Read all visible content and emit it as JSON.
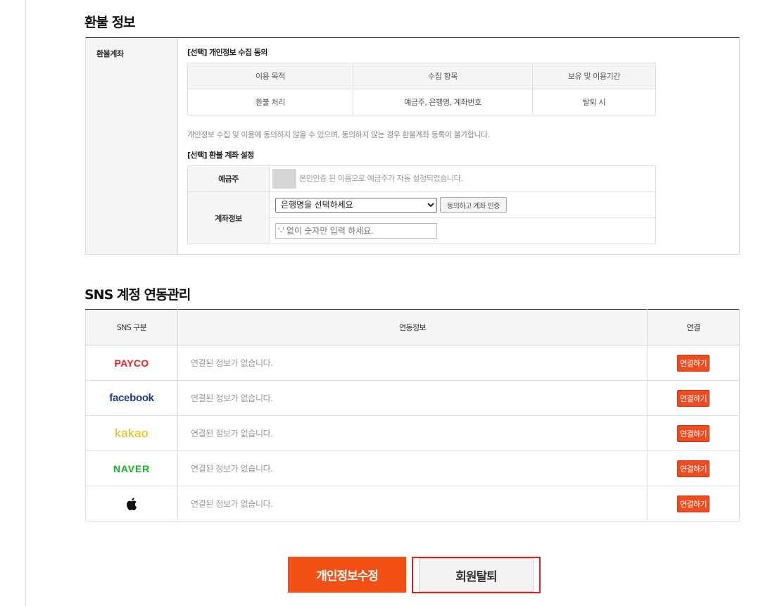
{
  "refund": {
    "title": "환불 정보",
    "row_header": "환불계좌",
    "consent_title": "[선택] 개인정보 수집 동의",
    "consent_table": {
      "headers": [
        "이용 목적",
        "수집 항목",
        "보유 및 이용기간"
      ],
      "row": [
        "환불 처리",
        "예금주, 은행명, 계좌번호",
        "탈퇴 시"
      ]
    },
    "notice": "개인정보 수집 및 이용에 동의하지 않을 수 있으며, 동의하지 않는 경우 환불계좌 등록이 불가합니다.",
    "account_title": "[선택] 환불 계좌 설정",
    "holder_label": "예금주",
    "holder_note": "본인인증 된 이름으로 예금주가 자동 설정되었습니다.",
    "account_label": "계좌정보",
    "bank_select": "은행명을 선택하세요",
    "verify_button": "동의하고 계좌 인증",
    "account_placeholder": "'-' 없이 숫자만 입력 하세요."
  },
  "sns": {
    "title": "SNS 계정 연동관리",
    "headers": [
      "SNS 구분",
      "연동정보",
      "연결"
    ],
    "rows": [
      {
        "provider": "PAYCO",
        "info": "연결된 정보가 없습니다.",
        "action": "연결하기"
      },
      {
        "provider": "facebook",
        "info": "연결된 정보가 없습니다.",
        "action": "연결하기"
      },
      {
        "provider": "kakao",
        "info": "연결된 정보가 없습니다.",
        "action": "연결하기"
      },
      {
        "provider": "NAVER",
        "info": "연결된 정보가 없습니다.",
        "action": "연결하기"
      },
      {
        "provider": "apple",
        "info": "연결된 정보가 없습니다.",
        "action": "연결하기"
      }
    ]
  },
  "buttons": {
    "edit": "개인정보수정",
    "withdraw": "회원탈퇴"
  },
  "colors": {
    "accent": "#f25014",
    "highlight": "#e01e1e"
  }
}
